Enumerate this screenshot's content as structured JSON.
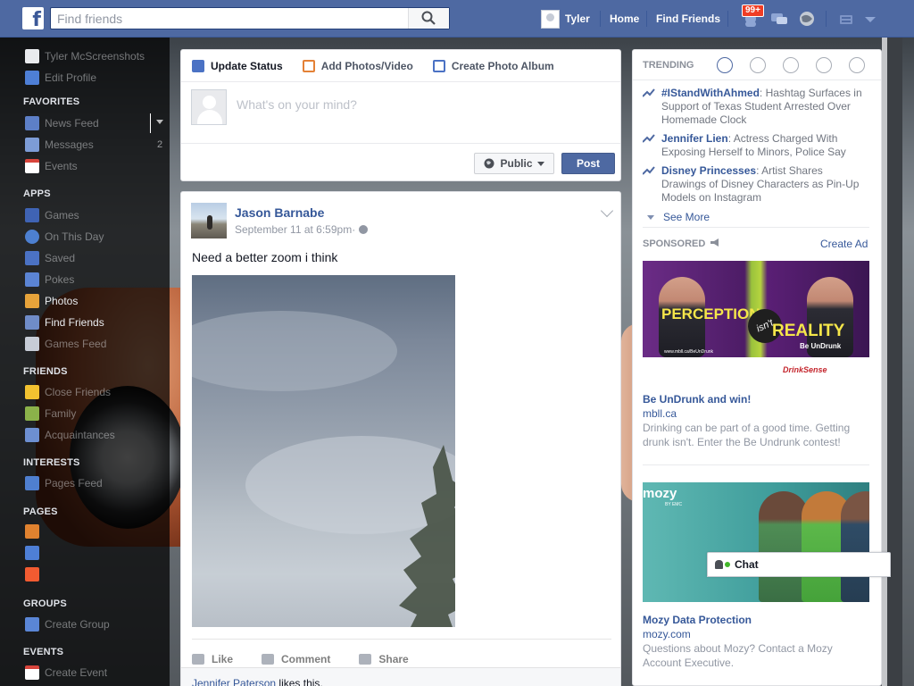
{
  "topbar": {
    "search_placeholder": "Find friends",
    "user_name": "Tyler",
    "nav_home": "Home",
    "nav_find_friends": "Find Friends",
    "notifications_badge": "99+",
    "icons": [
      "friend-requests-icon",
      "messages-icon",
      "notifications-icon",
      "privacy-icon",
      "account-menu-icon"
    ]
  },
  "sidebar": {
    "profile_name": "Tyler McScreenshots",
    "edit_profile": "Edit Profile",
    "favorites_header": "FAVORITES",
    "favorites": [
      {
        "label": "News Feed",
        "count": ""
      },
      {
        "label": "Messages",
        "count": "2"
      },
      {
        "label": "Events",
        "count": ""
      }
    ],
    "apps_header": "APPS",
    "apps": [
      {
        "label": "Games"
      },
      {
        "label": "On This Day"
      },
      {
        "label": "Saved"
      },
      {
        "label": "Pokes"
      },
      {
        "label": "Photos"
      },
      {
        "label": "Find Friends"
      },
      {
        "label": "Games Feed"
      }
    ],
    "friends_header": "FRIENDS",
    "friends": [
      {
        "label": "Close Friends"
      },
      {
        "label": "Family"
      },
      {
        "label": "Acquaintances"
      }
    ],
    "interests_header": "INTERESTS",
    "interests": [
      {
        "label": "Pages Feed"
      }
    ],
    "pages_header": "PAGES",
    "groups_header": "GROUPS",
    "groups": [
      {
        "label": "Create Group"
      }
    ],
    "events_header": "EVENTS",
    "events": [
      {
        "label": "Create Event"
      }
    ]
  },
  "composer": {
    "tab_update_status": "Update Status",
    "tab_add_photos": "Add Photos/Video",
    "tab_create_album": "Create Photo Album",
    "placeholder": "What's on your mind?",
    "audience": "Public",
    "post_button": "Post"
  },
  "post": {
    "author": "Jason Barnabe",
    "timestamp": "September 11 at 6:59pm",
    "separator": " · ",
    "text": "Need a better zoom i think",
    "action_like": "Like",
    "action_comment": "Comment",
    "action_share": "Share",
    "liker": "Jennifer Paterson",
    "likes_suffix": " likes this."
  },
  "trending": {
    "header": "TRENDING",
    "tabs": [
      "trending-top-icon",
      "politics-icon",
      "science-icon",
      "sports-icon",
      "entertainment-icon"
    ],
    "items": [
      {
        "topic": "#IStandWithAhmed",
        "desc": ": Hashtag Surfaces in Support of Texas Student Arrested Over Homemade Clock"
      },
      {
        "topic": "Jennifer Lien",
        "desc": ": Actress Charged With Exposing Herself to Minors, Police Say"
      },
      {
        "topic": "Disney Princesses",
        "desc": ": Artist Shares Drawings of Disney Characters as Pin-Up Models on Instagram"
      }
    ],
    "see_more": "See More"
  },
  "sponsored": {
    "header": "SPONSORED",
    "create_ad": "Create Ad",
    "ads": [
      {
        "image_headline_1": "PERCEPTION",
        "image_badge": "isn't",
        "image_headline_2": "REALITY",
        "image_tag": "Be UnDrunk",
        "image_url": "www.mbll.ca/BeUnDrunk",
        "image_brand": "DrinkSense",
        "title": "Be UnDrunk and win!",
        "url": "mbll.ca",
        "desc": "Drinking can be part of a good time. Getting drunk isn't. Enter the Be Undrunk contest!"
      },
      {
        "image_logo": "mozy",
        "image_byline": "BY EMC",
        "title": "Mozy Data Protection",
        "url": "mozy.com",
        "desc": "Questions about Mozy? Contact a Mozy Account Executive."
      }
    ]
  },
  "chat": {
    "label": "Chat"
  },
  "colors": {
    "brand_blue": "#4e69a2",
    "link_blue": "#365899",
    "badge_red": "#f03d25",
    "online_green": "#42b72a"
  }
}
